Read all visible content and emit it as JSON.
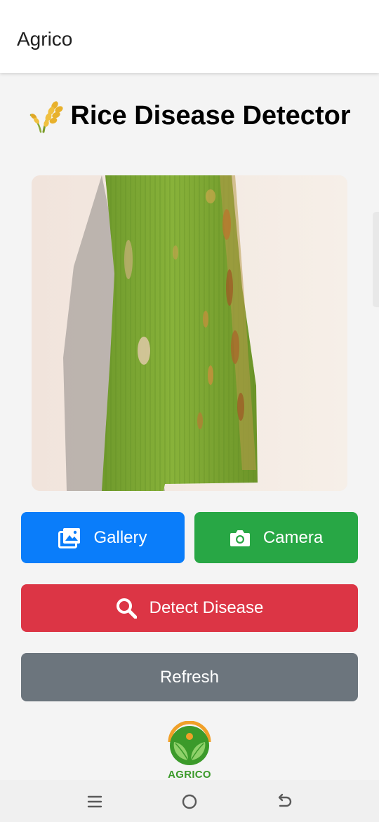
{
  "appbar": {
    "title": "Agrico"
  },
  "header": {
    "title": "Rice Disease Detector",
    "icon": "rice-plant-icon"
  },
  "preview": {
    "icon": "rice-leaf-photo"
  },
  "buttons": {
    "gallery": {
      "label": "Gallery",
      "icon": "gallery-icon"
    },
    "camera": {
      "label": "Camera",
      "icon": "camera-icon"
    },
    "detect": {
      "label": "Detect Disease",
      "icon": "search-icon"
    },
    "refresh": {
      "label": "Refresh"
    }
  },
  "footer": {
    "logo_text": "AGRICO",
    "logo_icon": "agrico-leaf-logo"
  },
  "nav": {
    "icons": [
      "menu-icon",
      "home-icon",
      "back-icon"
    ]
  },
  "colors": {
    "gallery": "#0a7dfa",
    "camera": "#28a745",
    "detect": "#dc3545",
    "refresh": "#6c757d",
    "logo_green": "#3b9a2a",
    "logo_orange": "#f0a028"
  }
}
